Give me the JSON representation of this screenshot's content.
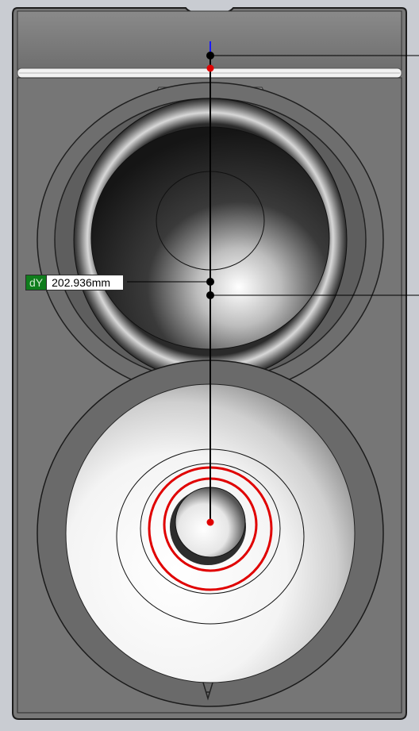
{
  "dimension": {
    "axis_label": "dY",
    "value": "202.936mm"
  },
  "colors": {
    "background": "#c9ccd2",
    "cabinet_body": "#777777",
    "cabinet_edge": "#1c1c1c",
    "sketch_line": "#000000",
    "selection_red": "#e00000",
    "axis_blue": "#1a1aff",
    "dimension_tag_green": "#0f7d1c"
  },
  "icons": {
    "logo": "brand-logo-icon"
  }
}
